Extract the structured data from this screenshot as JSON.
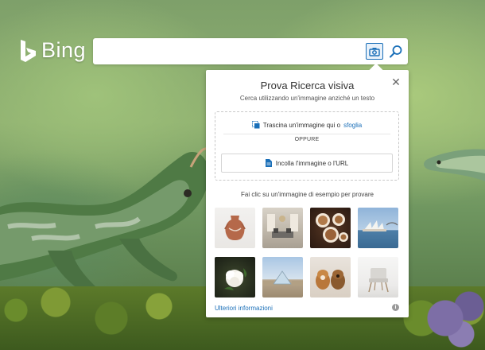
{
  "brand": {
    "name": "Bing"
  },
  "search": {
    "placeholder": "",
    "value": ""
  },
  "toolbar": {
    "camera_icon": "camera-icon",
    "search_icon": "search-icon"
  },
  "visual_search": {
    "title": "Prova Ricerca visiva",
    "subtitle": "Cerca utilizzando un'immagine anziché un testo",
    "drag_prefix": "Trascina un'immagine qui o",
    "drag_link": "sfoglia",
    "or_label": "OPPURE",
    "paste_label": "Incolla l'immagine o l'URL",
    "examples_caption": "Fai clic su un'immagine di esempio per provare",
    "more_info": "Ulteriori informazioni",
    "info_icon": "i",
    "close_icon": "✕",
    "examples": [
      {
        "subject": "vase"
      },
      {
        "subject": "room"
      },
      {
        "subject": "coffee"
      },
      {
        "subject": "sydney"
      },
      {
        "subject": "flower"
      },
      {
        "subject": "louvre"
      },
      {
        "subject": "dogs"
      },
      {
        "subject": "chair"
      }
    ]
  },
  "colors": {
    "accent": "#1a6fb8",
    "panel_bg": "#ffffff"
  }
}
